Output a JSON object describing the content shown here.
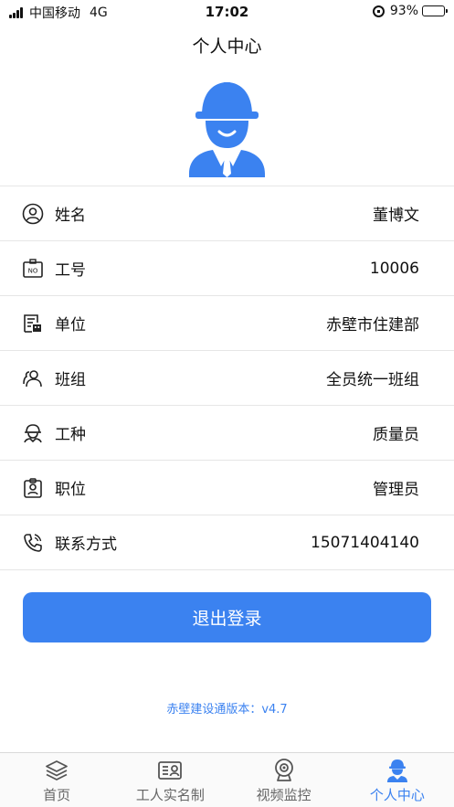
{
  "status_bar": {
    "carrier": "中国移动",
    "network": "4G",
    "time": "17:02",
    "battery": "93%",
    "battery_level": 0.93
  },
  "header": {
    "title": "个人中心"
  },
  "avatar": {
    "icon": "worker-helmet-icon",
    "color": "#3b82f0"
  },
  "profile": {
    "rows": [
      {
        "icon": "person-circle-icon",
        "label": "姓名",
        "value": "董博文"
      },
      {
        "icon": "id-badge-icon",
        "icon_text": "NO",
        "label": "工号",
        "value": "10006"
      },
      {
        "icon": "organization-icon",
        "label": "单位",
        "value": "赤壁市住建部"
      },
      {
        "icon": "group-icon",
        "label": "班组",
        "value": "全员统一班组"
      },
      {
        "icon": "hardhat-worker-icon",
        "label": "工种",
        "value": "质量员"
      },
      {
        "icon": "employee-card-icon",
        "label": "职位",
        "value": "管理员"
      },
      {
        "icon": "phone-icon",
        "label": "联系方式",
        "value": "15071404140"
      }
    ]
  },
  "actions": {
    "logout_label": "退出登录"
  },
  "footer": {
    "version": "赤壁建设通版本：v4.7"
  },
  "tabbar": {
    "items": [
      {
        "label": "首页",
        "icon": "layers-icon",
        "active": false
      },
      {
        "label": "工人实名制",
        "icon": "id-card-icon",
        "active": false
      },
      {
        "label": "视频监控",
        "icon": "webcam-icon",
        "active": false
      },
      {
        "label": "个人中心",
        "icon": "worker-icon",
        "active": true
      }
    ]
  },
  "colors": {
    "accent": "#3b82f0",
    "divider": "#e6e6e6",
    "text": "#111111"
  }
}
